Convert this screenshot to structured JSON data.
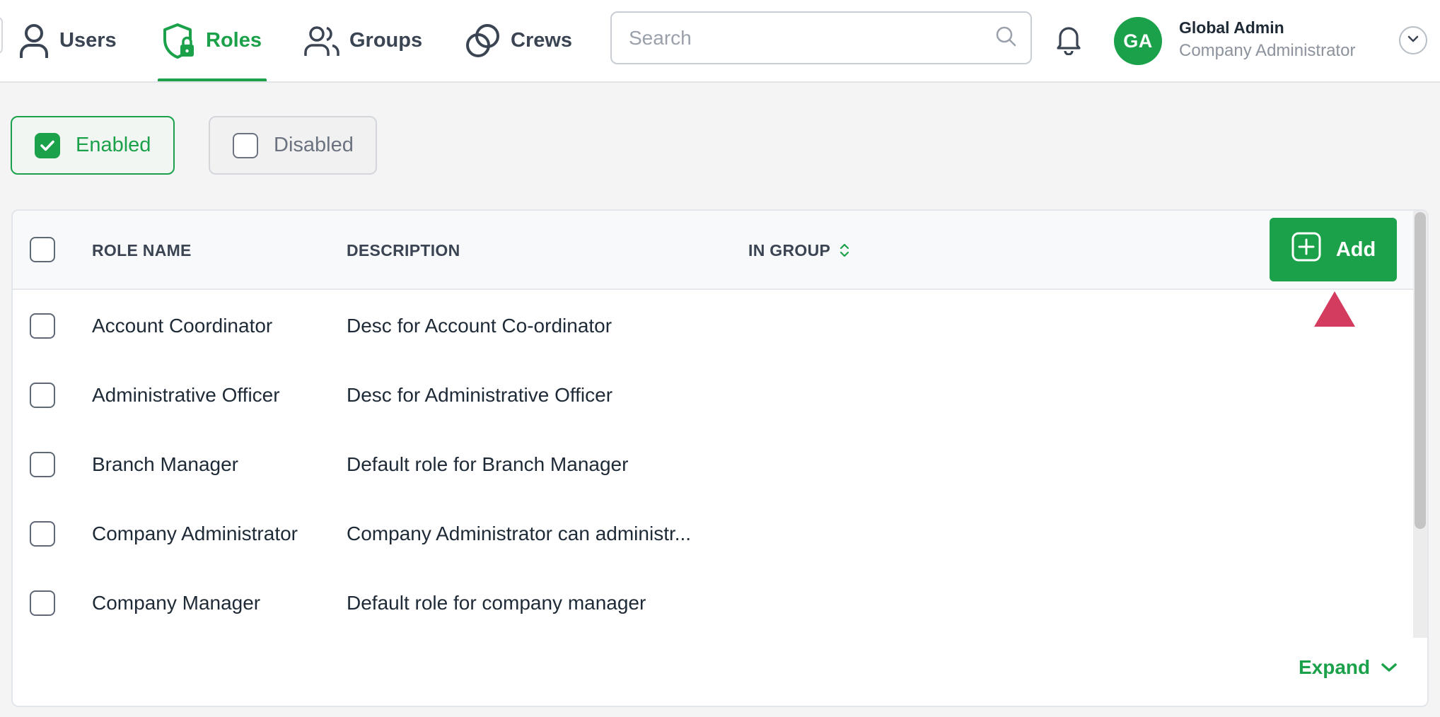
{
  "nav": {
    "tabs": [
      {
        "label": "Users",
        "icon": "user-icon",
        "active": false
      },
      {
        "label": "Roles",
        "icon": "shield-lock-icon",
        "active": true
      },
      {
        "label": "Groups",
        "icon": "users-icon",
        "active": false
      },
      {
        "label": "Crews",
        "icon": "circles-icon",
        "active": false
      }
    ],
    "search": {
      "placeholder": "Search",
      "value": ""
    },
    "user": {
      "initials": "GA",
      "name": "Global Admin",
      "role": "Company Administrator"
    }
  },
  "filters": {
    "enabled": {
      "label": "Enabled",
      "checked": true
    },
    "disabled": {
      "label": "Disabled",
      "checked": false
    }
  },
  "table": {
    "columns": [
      "ROLE NAME",
      "DESCRIPTION",
      "IN GROUP"
    ],
    "add_label": "Add",
    "rows": [
      {
        "name": "Account Coordinator",
        "description": "Desc for Account Co-ordinator"
      },
      {
        "name": "Administrative Officer",
        "description": "Desc for Administrative Officer"
      },
      {
        "name": "Branch Manager",
        "description": "Default role for Branch Manager"
      },
      {
        "name": "Company Administrator",
        "description": "Company Administrator can administr..."
      },
      {
        "name": "Company Manager",
        "description": "Default role for company manager"
      }
    ],
    "expand_label": "Expand"
  },
  "colors": {
    "accent": "#1aa14a",
    "pointer": "#d43c5f"
  }
}
